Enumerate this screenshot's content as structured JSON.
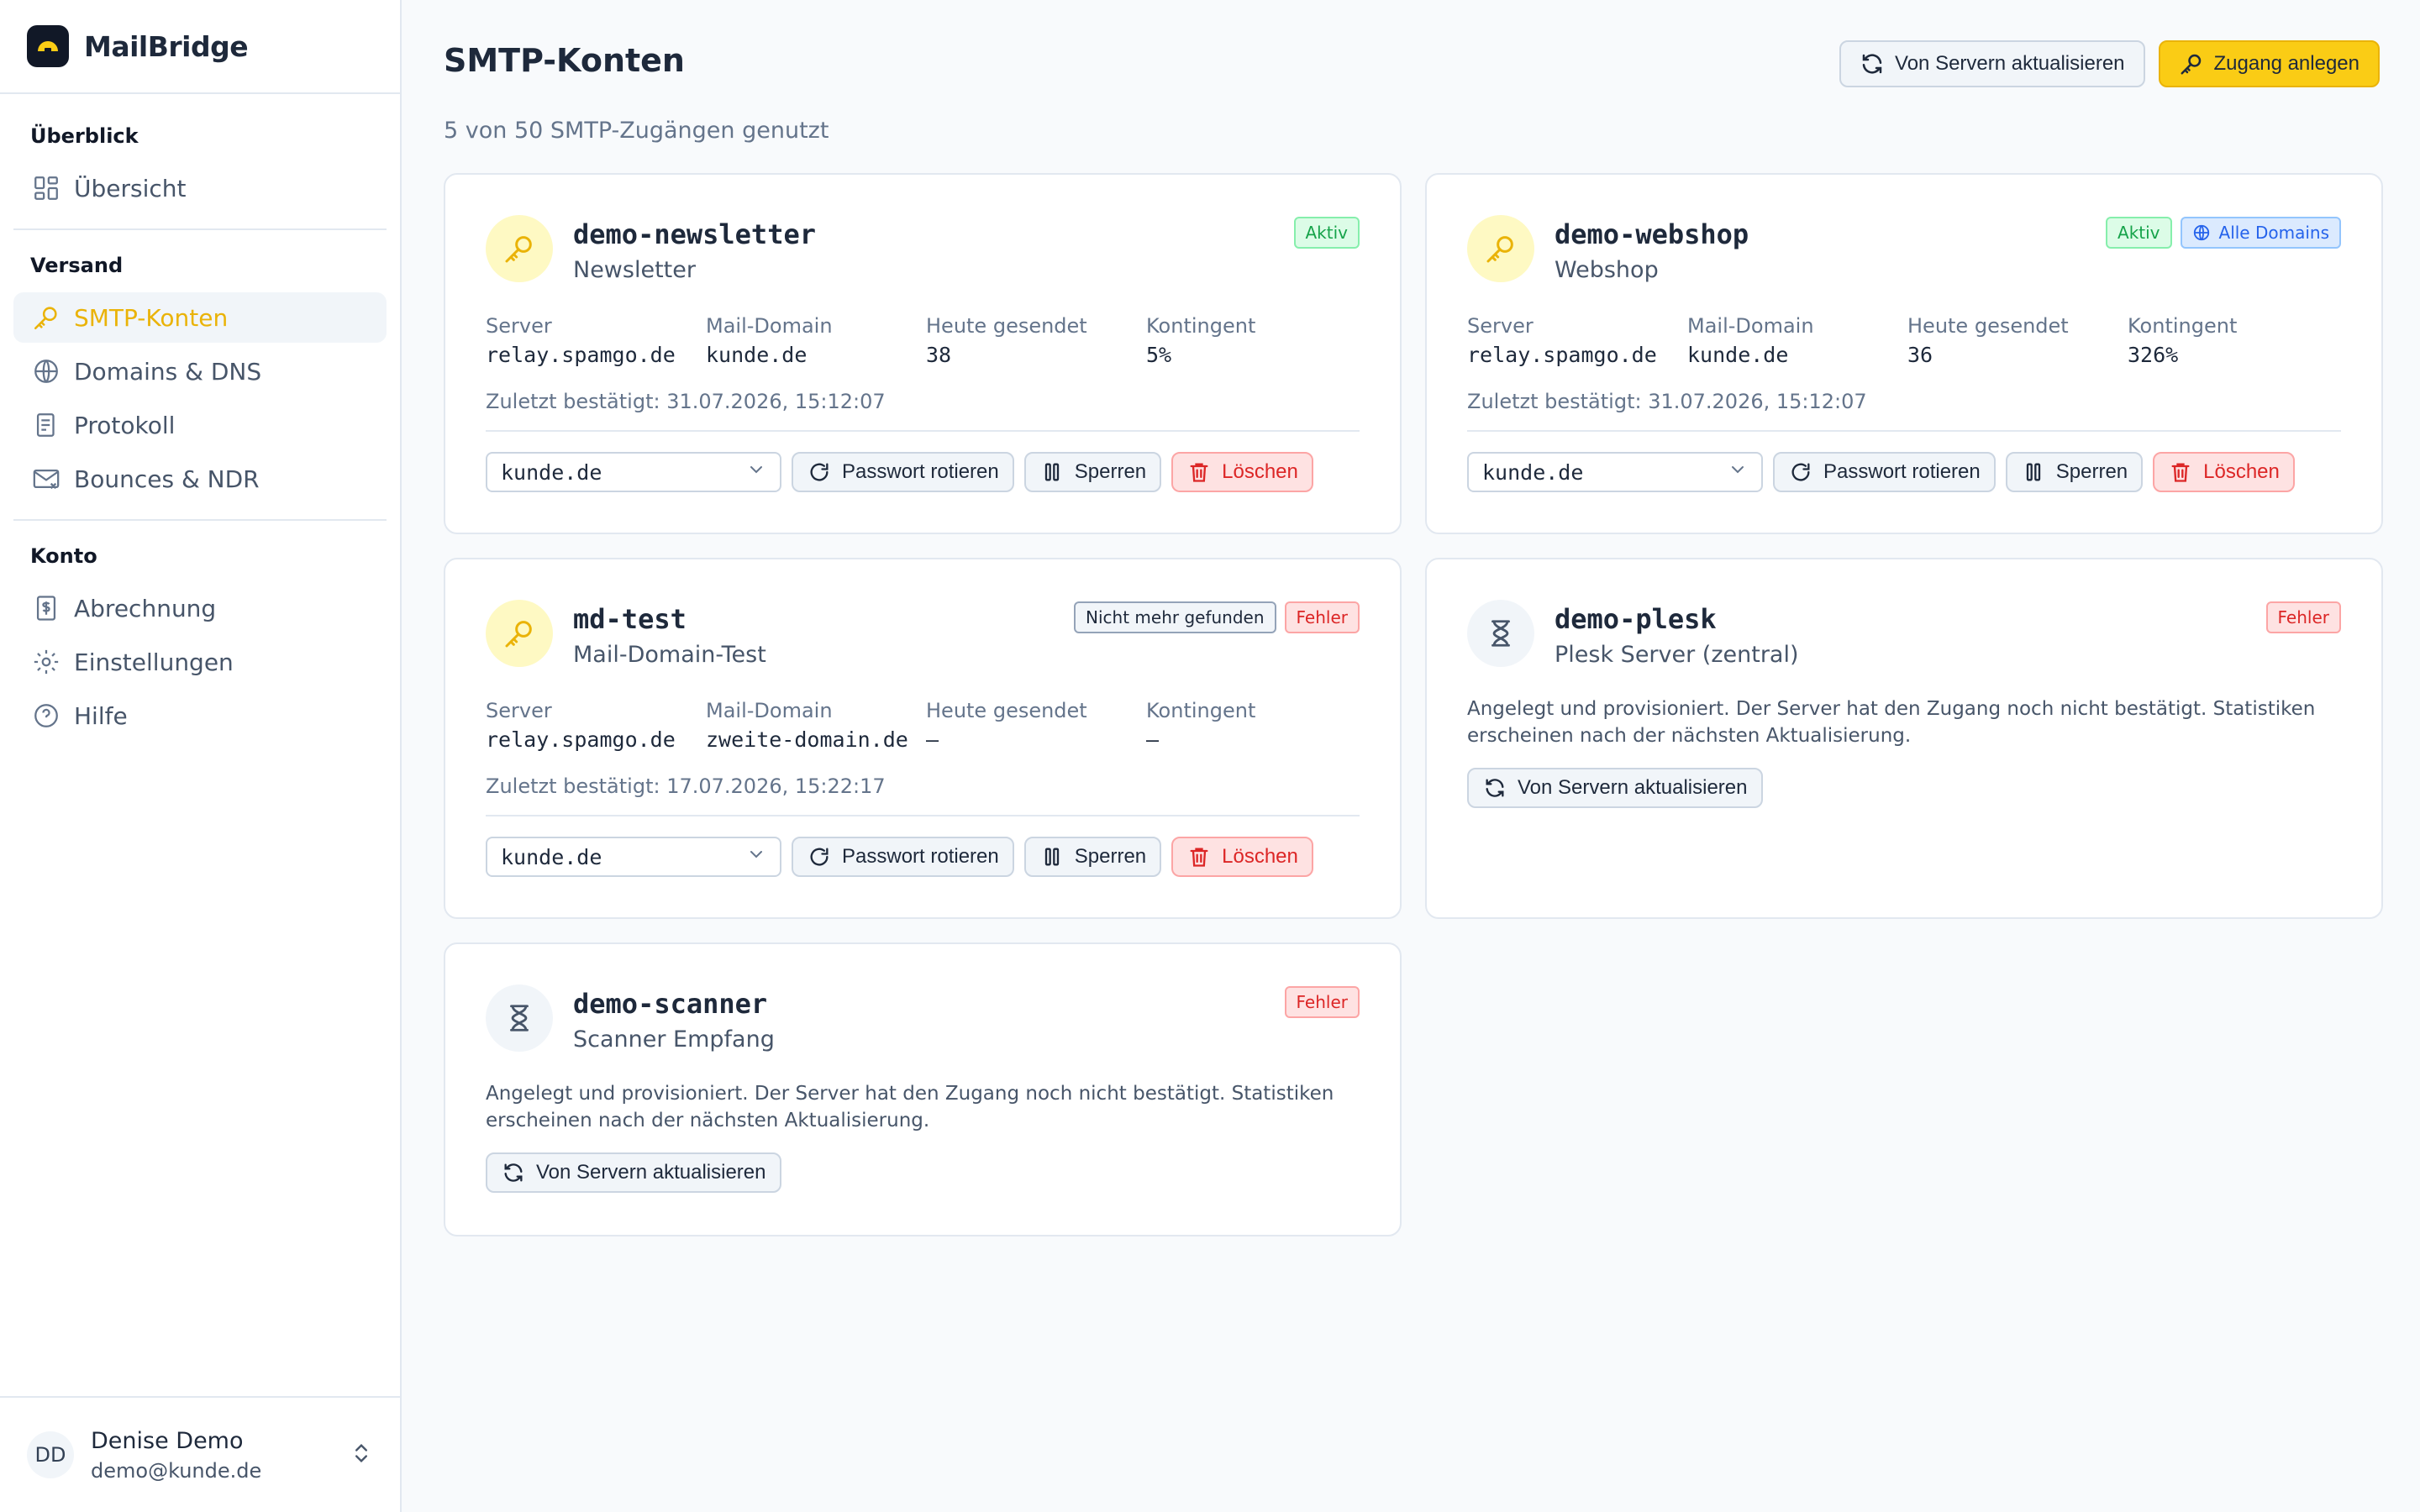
{
  "brand": {
    "name": "MailBridge"
  },
  "sidebar": {
    "sections": [
      {
        "heading": "Überblick",
        "items": [
          {
            "label": "Übersicht",
            "icon": "dashboard-icon"
          }
        ]
      },
      {
        "heading": "Versand",
        "items": [
          {
            "label": "SMTP-Konten",
            "icon": "key-icon",
            "active": true
          },
          {
            "label": "Domains & DNS",
            "icon": "globe-icon"
          },
          {
            "label": "Protokoll",
            "icon": "scroll-icon"
          },
          {
            "label": "Bounces & NDR",
            "icon": "mail-x-icon"
          }
        ]
      },
      {
        "heading": "Konto",
        "items": [
          {
            "label": "Abrechnung",
            "icon": "receipt-icon"
          },
          {
            "label": "Einstellungen",
            "icon": "gear-icon"
          },
          {
            "label": "Hilfe",
            "icon": "help-icon"
          }
        ]
      }
    ],
    "user": {
      "initials": "DD",
      "name": "Denise Demo",
      "email": "demo@kunde.de"
    }
  },
  "header": {
    "title": "SMTP-Konten",
    "subtitle": "5 von 50 SMTP-Zugängen genutzt",
    "refresh_label": "Von Servern aktualisieren",
    "create_label": "Zugang anlegen"
  },
  "labels": {
    "server": "Server",
    "mail_domain": "Mail-Domain",
    "sent_today": "Heute gesendet",
    "quota": "Kontingent",
    "rotate": "Passwort rotieren",
    "lock": "Sperren",
    "delete": "Löschen",
    "refresh": "Von Servern aktualisieren",
    "pending_text": "Angelegt und provisioniert. Der Server hat den Zugang noch nicht bestätigt. Statistiken erscheinen nach der nächsten Aktualisierung."
  },
  "accounts": [
    {
      "name": "demo-newsletter",
      "desc": "Newsletter",
      "state": "active",
      "badges": [
        {
          "text": "Aktiv",
          "style": "green"
        }
      ],
      "server": "relay.spamgo.de",
      "mail_domain": "kunde.de",
      "sent_today": "38",
      "quota": "5%",
      "confirmed": "Zuletzt bestätigt: 31.07.2026, 15:12:07",
      "domain_select": "kunde.de"
    },
    {
      "name": "demo-webshop",
      "desc": "Webshop",
      "state": "active",
      "badges": [
        {
          "text": "Aktiv",
          "style": "green"
        },
        {
          "text": "Alle Domains",
          "style": "blue",
          "icon": "globe-icon"
        }
      ],
      "server": "relay.spamgo.de",
      "mail_domain": "kunde.de",
      "sent_today": "36",
      "quota": "326%",
      "confirmed": "Zuletzt bestätigt: 31.07.2026, 15:12:07",
      "domain_select": "kunde.de"
    },
    {
      "name": "md-test",
      "desc": "Mail-Domain-Test",
      "state": "active",
      "badges": [
        {
          "text": "Nicht mehr gefunden",
          "style": "gray"
        },
        {
          "text": "Fehler",
          "style": "red"
        }
      ],
      "server": "relay.spamgo.de",
      "mail_domain": "zweite-domain.de",
      "sent_today": "—",
      "quota": "—",
      "confirmed": "Zuletzt bestätigt: 17.07.2026, 15:22:17",
      "domain_select": "kunde.de"
    },
    {
      "name": "demo-plesk",
      "desc": "Plesk Server (zentral)",
      "state": "pending",
      "badges": [
        {
          "text": "Fehler",
          "style": "red"
        }
      ]
    },
    {
      "name": "demo-scanner",
      "desc": "Scanner Empfang",
      "state": "pending",
      "badges": [
        {
          "text": "Fehler",
          "style": "red"
        }
      ]
    }
  ],
  "colors": {
    "accent": "#facc15",
    "accent_text": "#eab308",
    "danger": "#dc2626",
    "success": "#16a34a"
  }
}
